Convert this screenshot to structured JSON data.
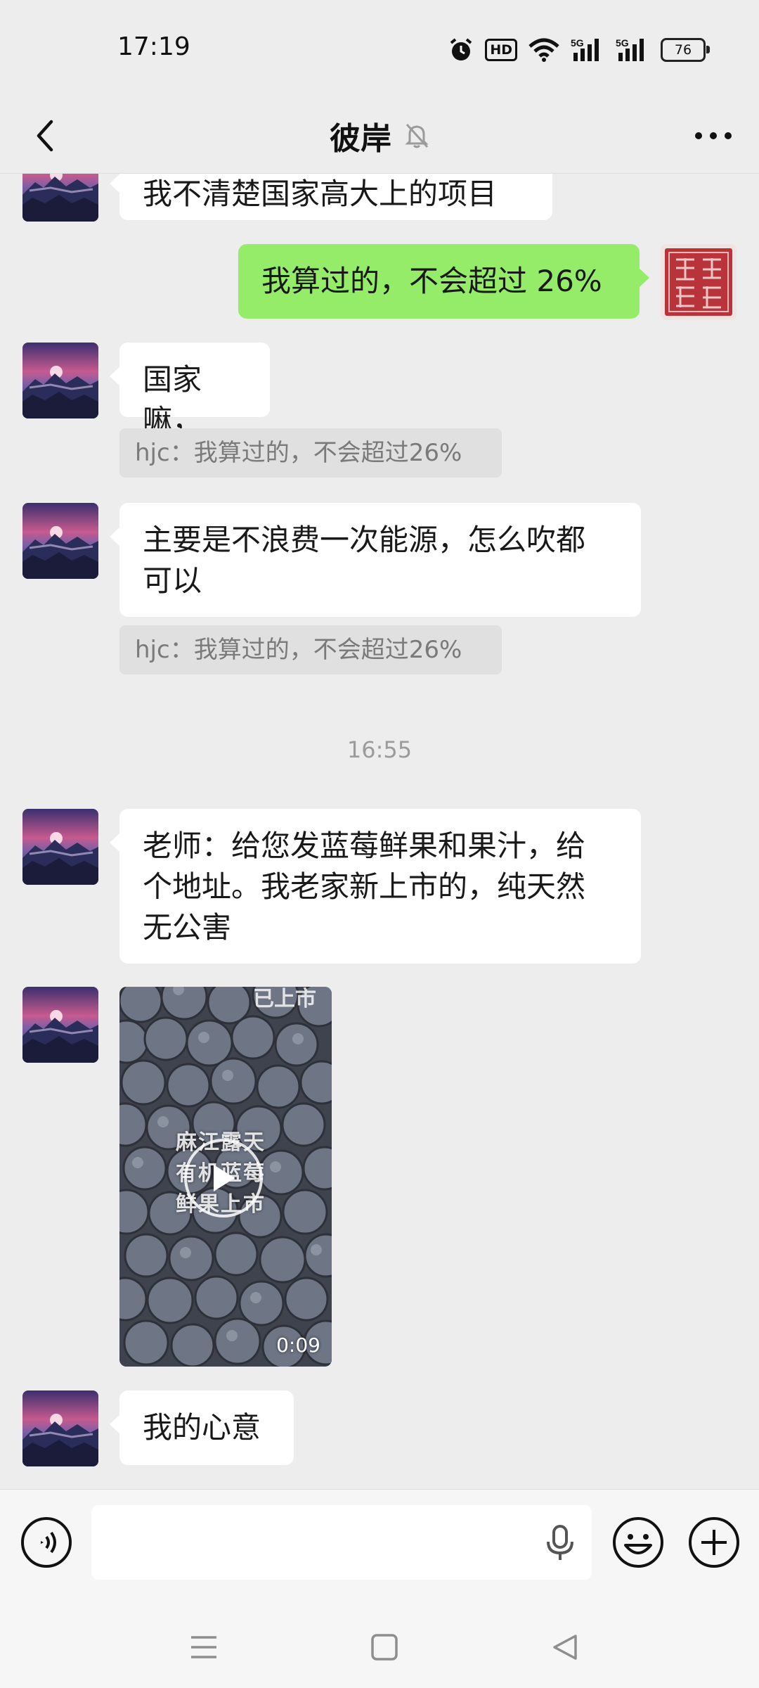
{
  "status_bar": {
    "time": "17:19",
    "hd_label": "HD",
    "sim1": "5G",
    "sim2": "5G",
    "battery": "76"
  },
  "header": {
    "title": "彼岸",
    "icons": {
      "back": "chevron-left",
      "muted": "bell-off",
      "more": "ellipsis"
    }
  },
  "messages": [
    {
      "side": "left",
      "text": "我不清楚国家高大上的项目"
    },
    {
      "side": "right",
      "text": "我算过的，不会超过 26%"
    },
    {
      "side": "left",
      "text": "国家嘛，",
      "quote": "hjc：我算过的，不会超过26%"
    },
    {
      "side": "left",
      "text_line1": "主要是不浪费一次能源，怎么吹都",
      "text_line2": "可以",
      "quote": "hjc：我算过的，不会超过26%"
    },
    {
      "type": "timestamp",
      "text": "16:55"
    },
    {
      "side": "left",
      "text_line1": "老师：给您发蓝莓鲜果和果汁，给",
      "text_line2": "个地址。我老家新上市的，纯天然",
      "text_line3": "无公害"
    },
    {
      "side": "left",
      "type": "video",
      "overlay_top": "已上市",
      "overlay_line1": "麻江露天",
      "overlay_line2": "有机蓝莓",
      "overlay_line3": "鲜果上市",
      "duration": "0:09"
    },
    {
      "side": "left",
      "text": "我的心意"
    }
  ],
  "input_bar": {
    "icons": {
      "voice": "voice-wave",
      "mic": "microphone",
      "emoji": "smiley",
      "add": "plus-circle"
    },
    "text_value": ""
  },
  "system_nav": {
    "icons": [
      "menu",
      "home-square",
      "back-triangle"
    ]
  },
  "colors": {
    "background": "#ededed",
    "sent_bubble": "#95ec69",
    "received_bubble": "#ffffff",
    "quote_bg": "#e0e0e0"
  }
}
